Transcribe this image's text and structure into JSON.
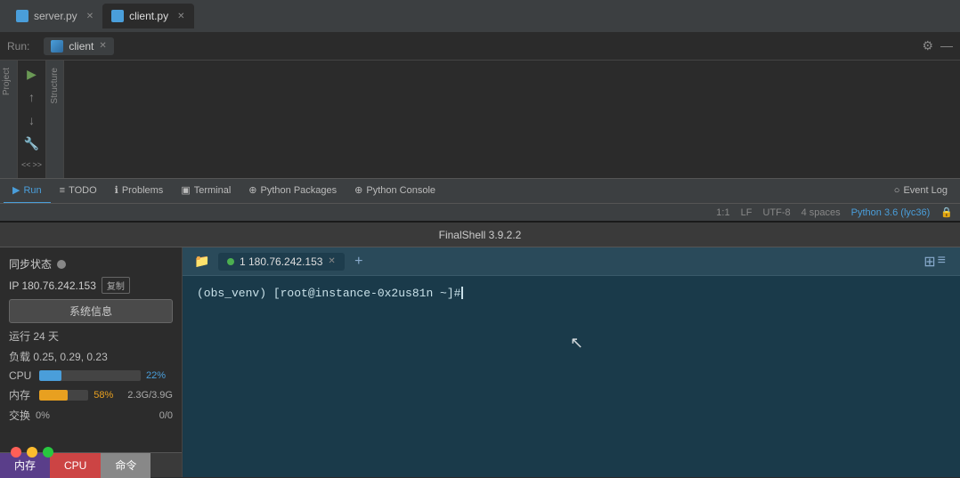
{
  "pycharm": {
    "tabs": [
      {
        "label": "server.py",
        "active": false
      },
      {
        "label": "client.py",
        "active": true
      }
    ],
    "run_label": "Run:",
    "run_tab": "client",
    "bottom_tabs": [
      {
        "label": "Run",
        "icon": "▶",
        "active": true
      },
      {
        "label": "TODO",
        "icon": "≡",
        "active": false
      },
      {
        "label": "Problems",
        "icon": "ℹ",
        "active": false
      },
      {
        "label": "Terminal",
        "icon": "▣",
        "active": false
      },
      {
        "label": "Python Packages",
        "icon": "⊕",
        "active": false
      },
      {
        "label": "Python Console",
        "icon": "⊕",
        "active": false
      },
      {
        "label": "Event Log",
        "icon": "○",
        "active": false
      }
    ],
    "status_bar": {
      "position": "1:1",
      "line_ending": "LF",
      "encoding": "UTF-8",
      "indent": "4 spaces",
      "interpreter": "Python 3.6 (lyc36)",
      "lock": "🔒"
    },
    "sidebar_labels": [
      "Project",
      "Structure"
    ]
  },
  "finalshell": {
    "title": "FinalShell 3.9.2.2",
    "info_panel": {
      "sync_status_label": "同步状态",
      "ip_label": "IP 180.76.242.153",
      "copy_label": "复制",
      "sys_info_label": "系统信息",
      "uptime_label": "运行 24 天",
      "load_label": "负载 0.25, 0.29, 0.23",
      "cpu_label": "CPU",
      "cpu_percent": "22%",
      "cpu_value": 22,
      "mem_label": "内存",
      "mem_percent": "58%",
      "mem_value": 58,
      "mem_detail": "2.3G/3.9G",
      "swap_label": "交换",
      "swap_percent": "0%",
      "swap_value": 0,
      "swap_detail": "0/0"
    },
    "bottom_tabs": [
      {
        "label": "内存",
        "type": "mem"
      },
      {
        "label": "CPU",
        "type": "cpu"
      },
      {
        "label": "命令",
        "type": "cmd"
      }
    ],
    "terminal": {
      "tab_label": "1 180.76.242.153",
      "prompt": "(obs_venv) [root@instance-0x2us81n ~]# "
    }
  }
}
